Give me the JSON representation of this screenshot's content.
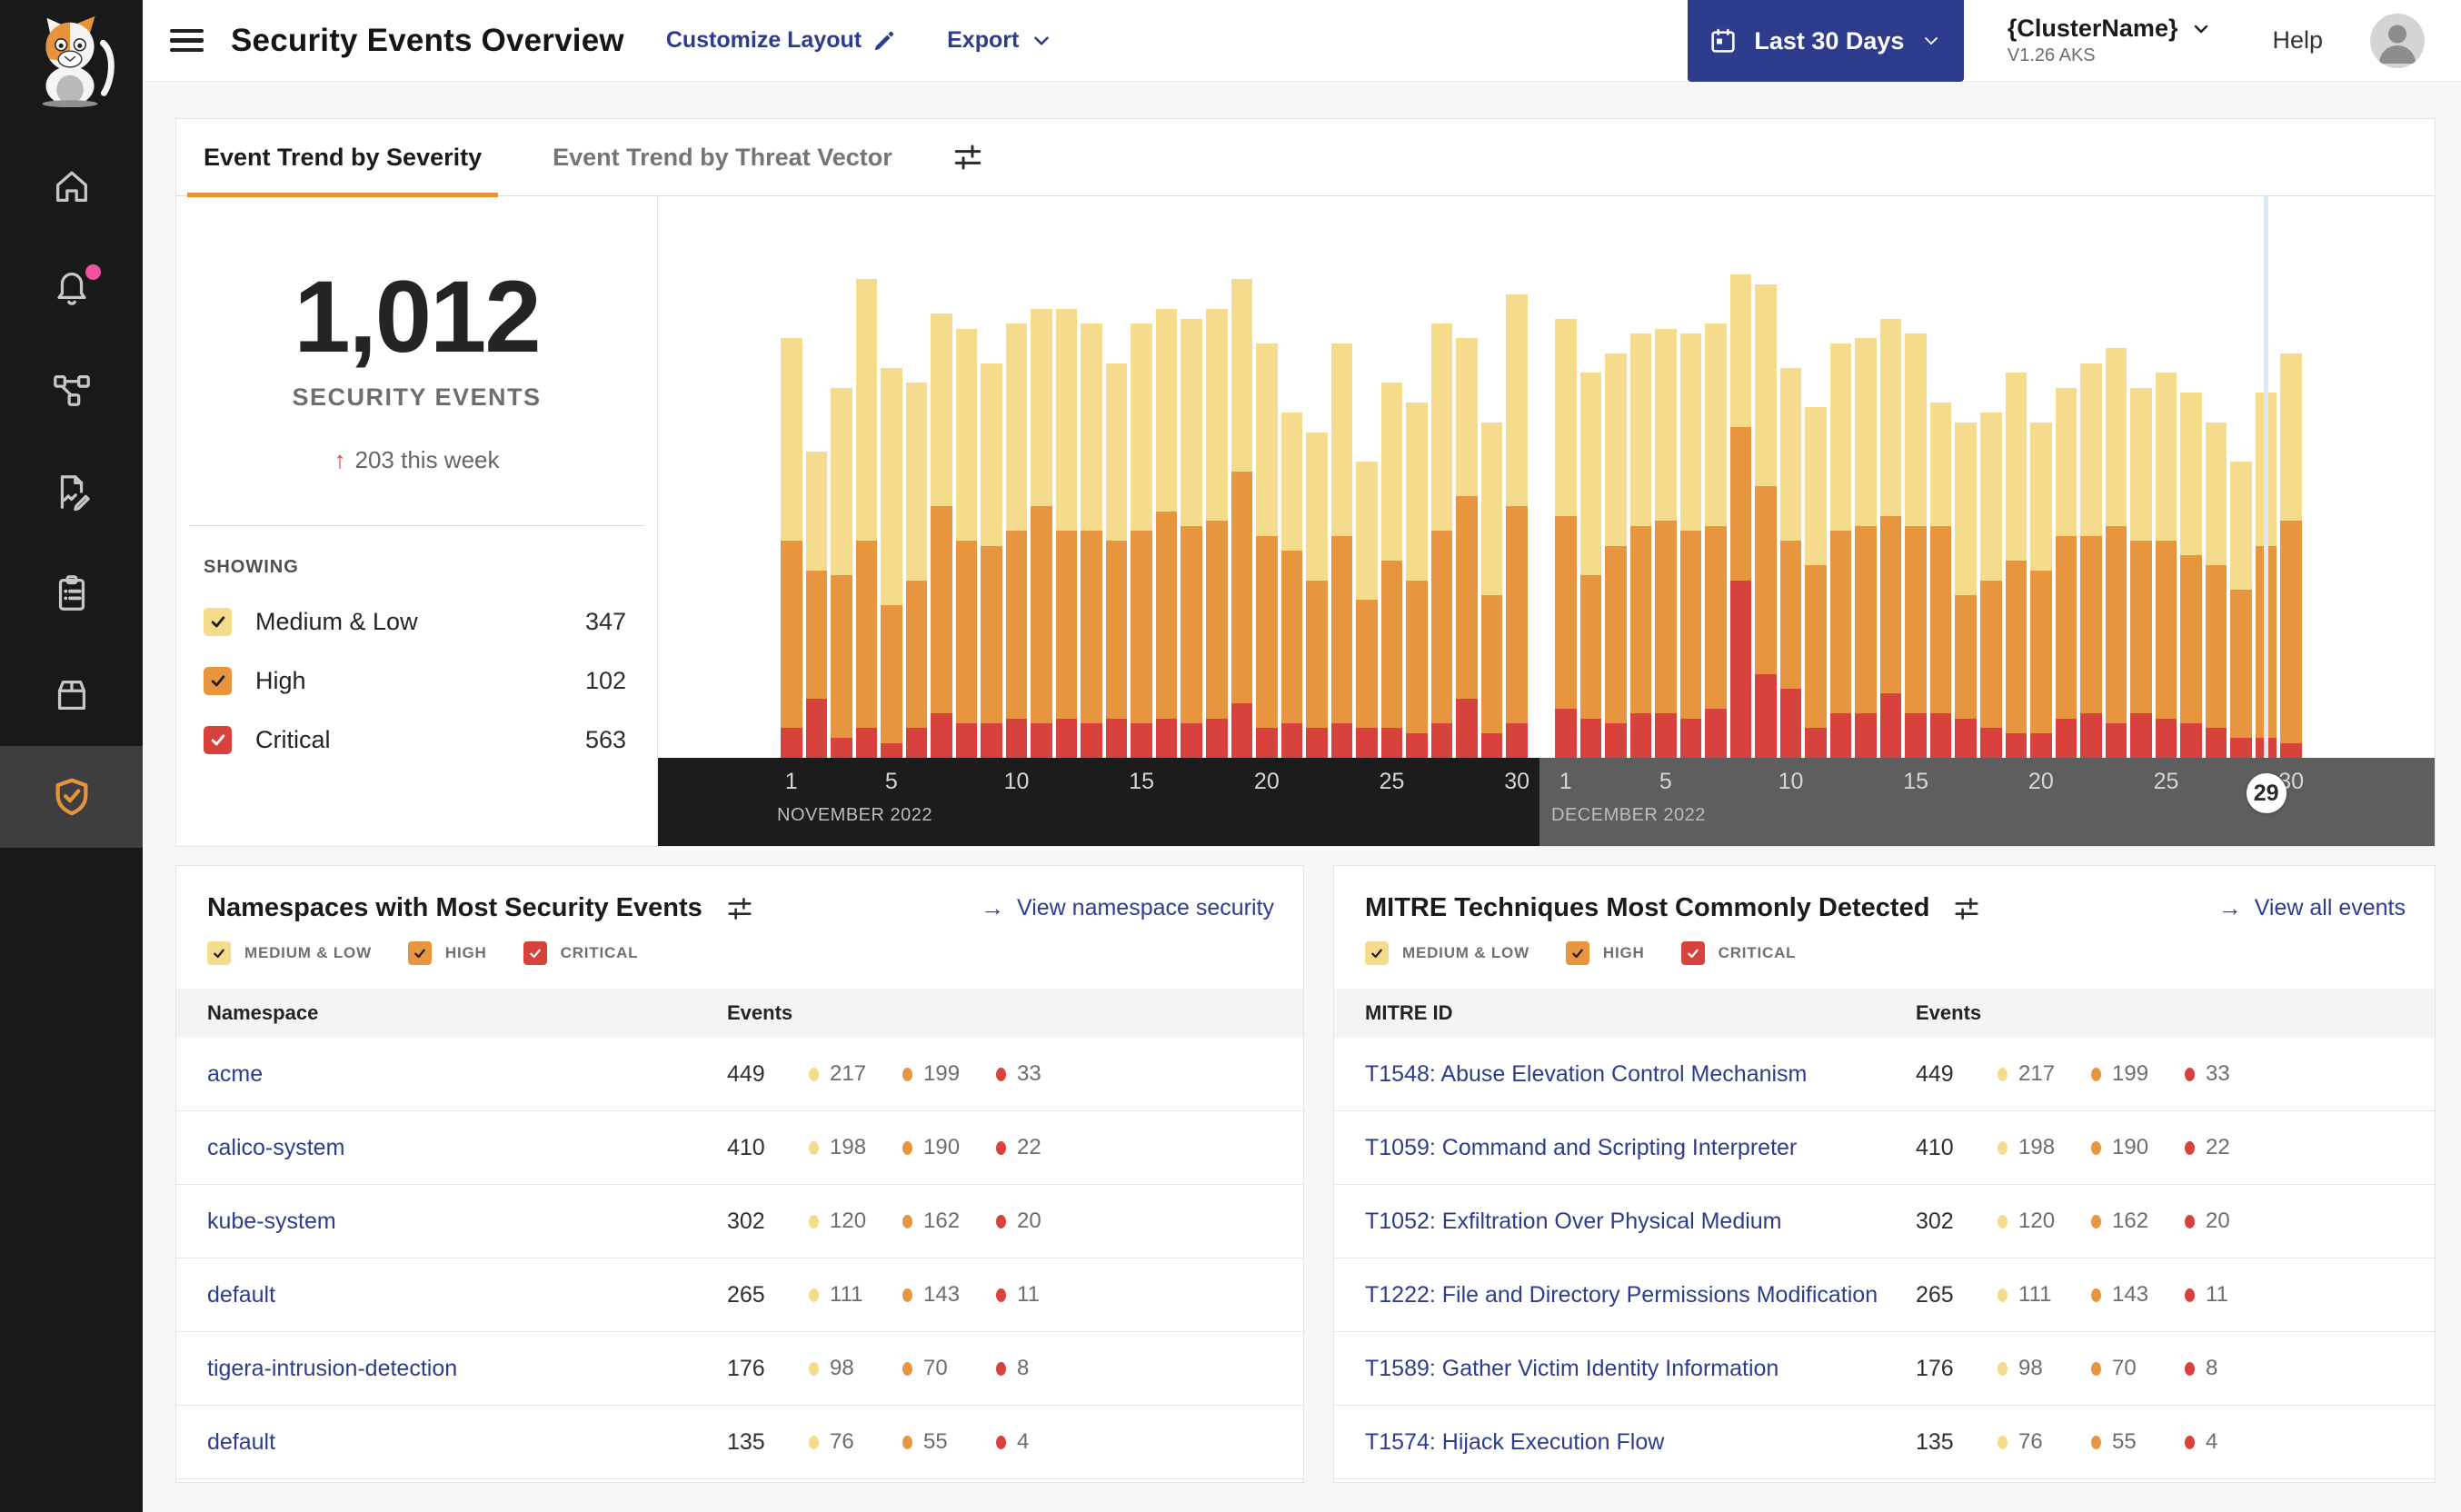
{
  "brand": {
    "navy": "#2E3C8E",
    "accent_orange": "#E8923C",
    "pink_dot": "#F0519E"
  },
  "severity_colors": {
    "medium_low": "#F4DC8C",
    "high": "#E8953F",
    "critical": "#D8423D"
  },
  "severity_filter_labels": [
    "MEDIUM & LOW",
    "HIGH",
    "CRITICAL"
  ],
  "sidebar": {
    "logo_icon": "calico-cat-logo",
    "items": [
      {
        "icon": "home-icon",
        "active": false,
        "notification": false
      },
      {
        "icon": "bell-icon",
        "active": false,
        "notification": true
      },
      {
        "icon": "service-graph-icon",
        "active": false,
        "notification": false
      },
      {
        "icon": "policy-edit-icon",
        "active": false,
        "notification": false
      },
      {
        "icon": "clipboard-icon",
        "active": false,
        "notification": false
      },
      {
        "icon": "box-icon",
        "active": false,
        "notification": false
      },
      {
        "icon": "shield-check-icon",
        "active": true,
        "notification": false
      }
    ]
  },
  "header": {
    "title": "Security Events Overview",
    "customize_layout": "Customize Layout",
    "export": "Export",
    "date_range": "Last 30 Days",
    "cluster_name": "{ClusterName}",
    "cluster_version": "V1.26 AKS",
    "help": "Help"
  },
  "tabs": [
    {
      "label": "Event Trend by Severity",
      "active": true
    },
    {
      "label": "Event Trend by Threat Vector",
      "active": false
    }
  ],
  "summary": {
    "total": "1,012",
    "label": "SECURITY EVENTS",
    "delta_arrow": "↑",
    "delta": "203 this week",
    "showing_label": "SHOWING",
    "filters": [
      {
        "label": "Medium & Low",
        "count": "347",
        "severity": "medium_low",
        "checked": true
      },
      {
        "label": "High",
        "count": "102",
        "severity": "high",
        "checked": true
      },
      {
        "label": "Critical",
        "count": "563",
        "severity": "critical",
        "checked": true
      }
    ]
  },
  "chart_data": {
    "type": "bar",
    "stacked": true,
    "title": "Event Trend by Severity",
    "legend": [
      "Medium & Low",
      "High",
      "Critical"
    ],
    "legend_position": "left-panel",
    "grid": false,
    "y_axis_visible": false,
    "units": "percent_of_plot_height_estimated",
    "x_ticks": [
      1,
      5,
      10,
      15,
      20,
      25,
      30
    ],
    "selected": {
      "month_index": 1,
      "day": 29,
      "label": "29"
    },
    "months": [
      {
        "label": "NOVEMBER 2022",
        "days": [
          {
            "d": 1,
            "critical": 6,
            "high": 38,
            "medium_low": 41
          },
          {
            "d": 2,
            "critical": 12,
            "high": 26,
            "medium_low": 24
          },
          {
            "d": 3,
            "critical": 4,
            "high": 33,
            "medium_low": 38
          },
          {
            "d": 4,
            "critical": 6,
            "high": 38,
            "medium_low": 53
          },
          {
            "d": 5,
            "critical": 3,
            "high": 28,
            "medium_low": 48
          },
          {
            "d": 6,
            "critical": 6,
            "high": 30,
            "medium_low": 40
          },
          {
            "d": 7,
            "critical": 9,
            "high": 42,
            "medium_low": 39
          },
          {
            "d": 8,
            "critical": 7,
            "high": 37,
            "medium_low": 43
          },
          {
            "d": 9,
            "critical": 7,
            "high": 36,
            "medium_low": 37
          },
          {
            "d": 10,
            "critical": 8,
            "high": 38,
            "medium_low": 42
          },
          {
            "d": 11,
            "critical": 7,
            "high": 44,
            "medium_low": 40
          },
          {
            "d": 12,
            "critical": 8,
            "high": 38,
            "medium_low": 45
          },
          {
            "d": 13,
            "critical": 7,
            "high": 39,
            "medium_low": 42
          },
          {
            "d": 14,
            "critical": 8,
            "high": 36,
            "medium_low": 36
          },
          {
            "d": 15,
            "critical": 7,
            "high": 39,
            "medium_low": 42
          },
          {
            "d": 16,
            "critical": 8,
            "high": 42,
            "medium_low": 41
          },
          {
            "d": 17,
            "critical": 7,
            "high": 40,
            "medium_low": 42
          },
          {
            "d": 18,
            "critical": 8,
            "high": 40,
            "medium_low": 43
          },
          {
            "d": 19,
            "critical": 11,
            "high": 47,
            "medium_low": 39
          },
          {
            "d": 20,
            "critical": 6,
            "high": 39,
            "medium_low": 39
          },
          {
            "d": 21,
            "critical": 7,
            "high": 35,
            "medium_low": 28
          },
          {
            "d": 22,
            "critical": 6,
            "high": 30,
            "medium_low": 30
          },
          {
            "d": 23,
            "critical": 7,
            "high": 38,
            "medium_low": 39
          },
          {
            "d": 24,
            "critical": 6,
            "high": 26,
            "medium_low": 28
          },
          {
            "d": 25,
            "critical": 6,
            "high": 34,
            "medium_low": 36
          },
          {
            "d": 26,
            "critical": 5,
            "high": 31,
            "medium_low": 36
          },
          {
            "d": 27,
            "critical": 7,
            "high": 39,
            "medium_low": 42
          },
          {
            "d": 28,
            "critical": 12,
            "high": 41,
            "medium_low": 32
          },
          {
            "d": 29,
            "critical": 5,
            "high": 28,
            "medium_low": 35
          },
          {
            "d": 30,
            "critical": 7,
            "high": 44,
            "medium_low": 43
          }
        ]
      },
      {
        "label": "DECEMBER 2022",
        "days": [
          {
            "d": 1,
            "critical": 10,
            "high": 39,
            "medium_low": 40
          },
          {
            "d": 2,
            "critical": 8,
            "high": 29,
            "medium_low": 41
          },
          {
            "d": 3,
            "critical": 7,
            "high": 36,
            "medium_low": 39
          },
          {
            "d": 4,
            "critical": 9,
            "high": 38,
            "medium_low": 39
          },
          {
            "d": 5,
            "critical": 9,
            "high": 39,
            "medium_low": 39
          },
          {
            "d": 6,
            "critical": 8,
            "high": 38,
            "medium_low": 40
          },
          {
            "d": 7,
            "critical": 10,
            "high": 37,
            "medium_low": 41
          },
          {
            "d": 8,
            "critical": 36,
            "high": 31,
            "medium_low": 31
          },
          {
            "d": 9,
            "critical": 17,
            "high": 38,
            "medium_low": 41
          },
          {
            "d": 10,
            "critical": 14,
            "high": 30,
            "medium_low": 35
          },
          {
            "d": 11,
            "critical": 6,
            "high": 33,
            "medium_low": 32
          },
          {
            "d": 12,
            "critical": 9,
            "high": 37,
            "medium_low": 38
          },
          {
            "d": 13,
            "critical": 9,
            "high": 38,
            "medium_low": 38
          },
          {
            "d": 14,
            "critical": 13,
            "high": 36,
            "medium_low": 40
          },
          {
            "d": 15,
            "critical": 9,
            "high": 38,
            "medium_low": 39
          },
          {
            "d": 16,
            "critical": 9,
            "high": 38,
            "medium_low": 25
          },
          {
            "d": 17,
            "critical": 8,
            "high": 25,
            "medium_low": 35
          },
          {
            "d": 18,
            "critical": 6,
            "high": 30,
            "medium_low": 34
          },
          {
            "d": 19,
            "critical": 5,
            "high": 35,
            "medium_low": 38
          },
          {
            "d": 20,
            "critical": 5,
            "high": 33,
            "medium_low": 30
          },
          {
            "d": 21,
            "critical": 8,
            "high": 37,
            "medium_low": 30
          },
          {
            "d": 22,
            "critical": 9,
            "high": 36,
            "medium_low": 35
          },
          {
            "d": 23,
            "critical": 7,
            "high": 40,
            "medium_low": 36
          },
          {
            "d": 24,
            "critical": 9,
            "high": 35,
            "medium_low": 31
          },
          {
            "d": 25,
            "critical": 8,
            "high": 36,
            "medium_low": 34
          },
          {
            "d": 26,
            "critical": 7,
            "high": 34,
            "medium_low": 33
          },
          {
            "d": 27,
            "critical": 6,
            "high": 33,
            "medium_low": 29
          },
          {
            "d": 28,
            "critical": 4,
            "high": 30,
            "medium_low": 26
          },
          {
            "d": 29,
            "critical": 4,
            "high": 39,
            "medium_low": 31
          },
          {
            "d": 30,
            "critical": 3,
            "high": 45,
            "medium_low": 34
          }
        ]
      }
    ]
  },
  "panels": {
    "namespaces": {
      "title": "Namespaces with Most Security Events",
      "link_arrow": "→",
      "link": "View namespace security",
      "columns": [
        "Namespace",
        "Events"
      ],
      "rows": [
        {
          "name": "acme",
          "total": "449",
          "medium_low": "217",
          "high": "199",
          "critical": "33"
        },
        {
          "name": "calico-system",
          "total": "410",
          "medium_low": "198",
          "high": "190",
          "critical": "22"
        },
        {
          "name": "kube-system",
          "total": "302",
          "medium_low": "120",
          "high": "162",
          "critical": "20"
        },
        {
          "name": "default",
          "total": "265",
          "medium_low": "111",
          "high": "143",
          "critical": "11"
        },
        {
          "name": "tigera-intrusion-detection",
          "total": "176",
          "medium_low": "98",
          "high": "70",
          "critical": "8"
        },
        {
          "name": "default",
          "total": "135",
          "medium_low": "76",
          "high": "55",
          "critical": "4"
        }
      ]
    },
    "mitre": {
      "title": "MITRE Techniques Most Commonly Detected",
      "link_arrow": "→",
      "link": "View all events",
      "columns": [
        "MITRE ID",
        "Events"
      ],
      "rows": [
        {
          "name": "T1548: Abuse Elevation Control Mechanism",
          "total": "449",
          "medium_low": "217",
          "high": "199",
          "critical": "33"
        },
        {
          "name": "T1059: Command and Scripting Interpreter",
          "total": "410",
          "medium_low": "198",
          "high": "190",
          "critical": "22"
        },
        {
          "name": "T1052: Exfiltration Over Physical Medium",
          "total": "302",
          "medium_low": "120",
          "high": "162",
          "critical": "20"
        },
        {
          "name": "T1222: File and Directory Permissions Modification",
          "total": "265",
          "medium_low": "111",
          "high": "143",
          "critical": "11"
        },
        {
          "name": "T1589: Gather Victim Identity Information",
          "total": "176",
          "medium_low": "98",
          "high": "70",
          "critical": "8"
        },
        {
          "name": "T1574: Hijack Execution Flow",
          "total": "135",
          "medium_low": "76",
          "high": "55",
          "critical": "4"
        }
      ]
    }
  }
}
